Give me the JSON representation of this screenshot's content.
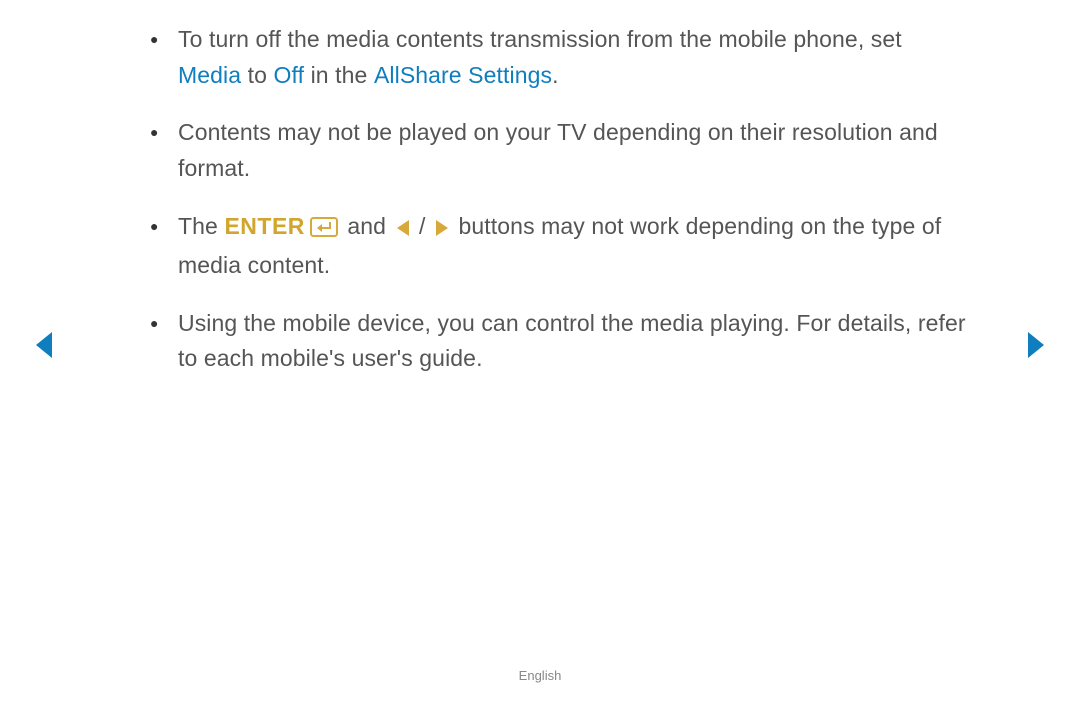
{
  "bullets": {
    "b1a": "To turn off the media contents transmission from the mobile phone, set ",
    "b1_media": "Media",
    "b1_to": " to ",
    "b1_off": "Off",
    "b1_inthe": " in the ",
    "b1_allshare": "AllShare Settings",
    "b1_period": ".",
    "b2": "Contents may not be played on your TV depending on their resolution and format.",
    "b3a": "The ",
    "b3_enter": "ENTER",
    "b3b": " and ",
    "b3_slash": " / ",
    "b3c": " buttons may not work depending on the type of media content.",
    "b4": "Using the mobile device, you can control the media playing. For details, refer to each mobile's user's guide."
  },
  "footer": "English",
  "colors": {
    "accent_blue": "#0e7ebf",
    "icon_gold": "#d7a83a"
  }
}
